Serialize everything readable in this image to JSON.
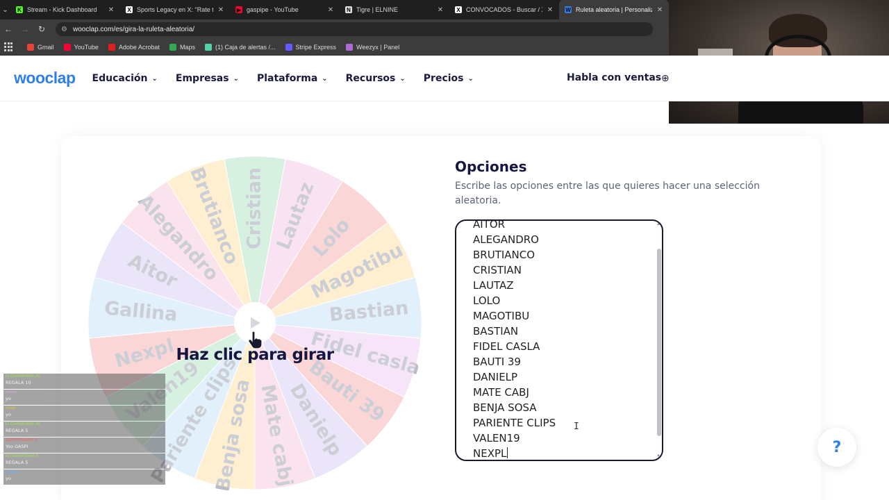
{
  "browser": {
    "tabs": [
      {
        "title": "Stream - Kick Dashboard",
        "favicon_color": "#53fc18",
        "glyph": "K"
      },
      {
        "title": "Sports Legacy en X: \"Rate this s",
        "favicon_color": "#ffffff",
        "glyph": "X"
      },
      {
        "title": "gaspipe - YouTube",
        "favicon_color": "#ff0033",
        "glyph": "▶"
      },
      {
        "title": "Tigre | ELNINE",
        "favicon_color": "#e0e0e0",
        "glyph": "N"
      },
      {
        "title": "CONVOCADOS - Buscar / X",
        "favicon_color": "#ffffff",
        "glyph": "X"
      },
      {
        "title": "Ruleta aleatoria | Personaliza y",
        "favicon_color": "#2f7fe6",
        "glyph": "W"
      }
    ],
    "url": "wooclap.com/es/gira-la-ruleta-aleatoria/",
    "bookmarks": [
      {
        "label": "Gmail",
        "color": "#ea4335"
      },
      {
        "label": "YouTube",
        "color": "#ff0033"
      },
      {
        "label": "Adobe Acrobat",
        "color": "#e02020"
      },
      {
        "label": "Maps",
        "color": "#34a853"
      },
      {
        "label": "(1) Caja de alertas /...",
        "color": "#53d3a8"
      },
      {
        "label": "Stripe Express",
        "color": "#635bff"
      },
      {
        "label": "Weezyx | Panel",
        "color": "#b06ad8"
      }
    ]
  },
  "site": {
    "logo": "wooclap",
    "nav": [
      "Educación",
      "Empresas",
      "Plataforma",
      "Recursos",
      "Precios"
    ],
    "sales": "Habla con ventas",
    "accent": "#2f7fe6"
  },
  "wheel": {
    "spin_label": "Haz clic para girar",
    "segments": [
      {
        "label": "Cristian",
        "color": "#c8ecd6"
      },
      {
        "label": "Lautaz",
        "color": "#f7d7ee"
      },
      {
        "label": "Lolo",
        "color": "#f8c7c7"
      },
      {
        "label": "Magotibu",
        "color": "#fde9bd"
      },
      {
        "label": "Bastian",
        "color": "#d6eaf9"
      },
      {
        "label": "Fidel casla",
        "color": "#f3dcf7"
      },
      {
        "label": "Bauti 39",
        "color": "#f8c7c7"
      },
      {
        "label": "Danielp",
        "color": "#e4dbf8"
      },
      {
        "label": "Mate cabj",
        "color": "#f8d9e7"
      },
      {
        "label": "Benja sosa",
        "color": "#fde9bd"
      },
      {
        "label": "Pariente clips",
        "color": "#d6eaf9"
      },
      {
        "label": "Valen19",
        "color": "#c8ecd6"
      },
      {
        "label": "Nexpl",
        "color": "#f8c7c7"
      },
      {
        "label": "Gallina",
        "color": "#d6eaf9"
      },
      {
        "label": "Aitor",
        "color": "#e4dbf8"
      },
      {
        "label": "Alegandro",
        "color": "#f8d9e7"
      },
      {
        "label": "Brutianco",
        "color": "#fde9bd"
      }
    ]
  },
  "options": {
    "title": "Opciones",
    "description": "Escribe las opciones entre las que quieres hacer una selección aleatoria.",
    "items": [
      "AITOR",
      "ALEGANDRO",
      "BRUTIANCO",
      "CRISTIAN",
      "LAUTAZ",
      "LOLO",
      "MAGOTIBU",
      "BASTIAN",
      "FIDEL CASLA",
      "BAUTI 39",
      "DANIELP",
      "MATE CABJ",
      "BENJA SOSA",
      "PARIENTE CLIPS",
      "VALEN19",
      "NEXPL"
    ]
  },
  "help": {
    "label": "?"
  },
  "chat": [
    {
      "user": "ELCHAMANBALUN",
      "user_color": "#a6e05a",
      "msg": "REGALA 10"
    },
    {
      "user": "chuchi",
      "user_color": "#d8a0f0",
      "msg": "yo"
    },
    {
      "user": "nutelo",
      "user_color": "#f0c040",
      "msg": "yo"
    },
    {
      "user": "ELCHAMANBALUN",
      "user_color": "#a6e05a",
      "msg": "REGALA 5"
    },
    {
      "user": "ESPORTSMASTR",
      "user_color": "#ff6060",
      "msg": "Yoo GASPI"
    },
    {
      "user": "ELCHAMANBALUN",
      "user_color": "#a6e05a",
      "msg": "REGALA 5"
    },
    {
      "user": "tomitoo",
      "user_color": "#60b0ff",
      "msg": "yo"
    }
  ]
}
